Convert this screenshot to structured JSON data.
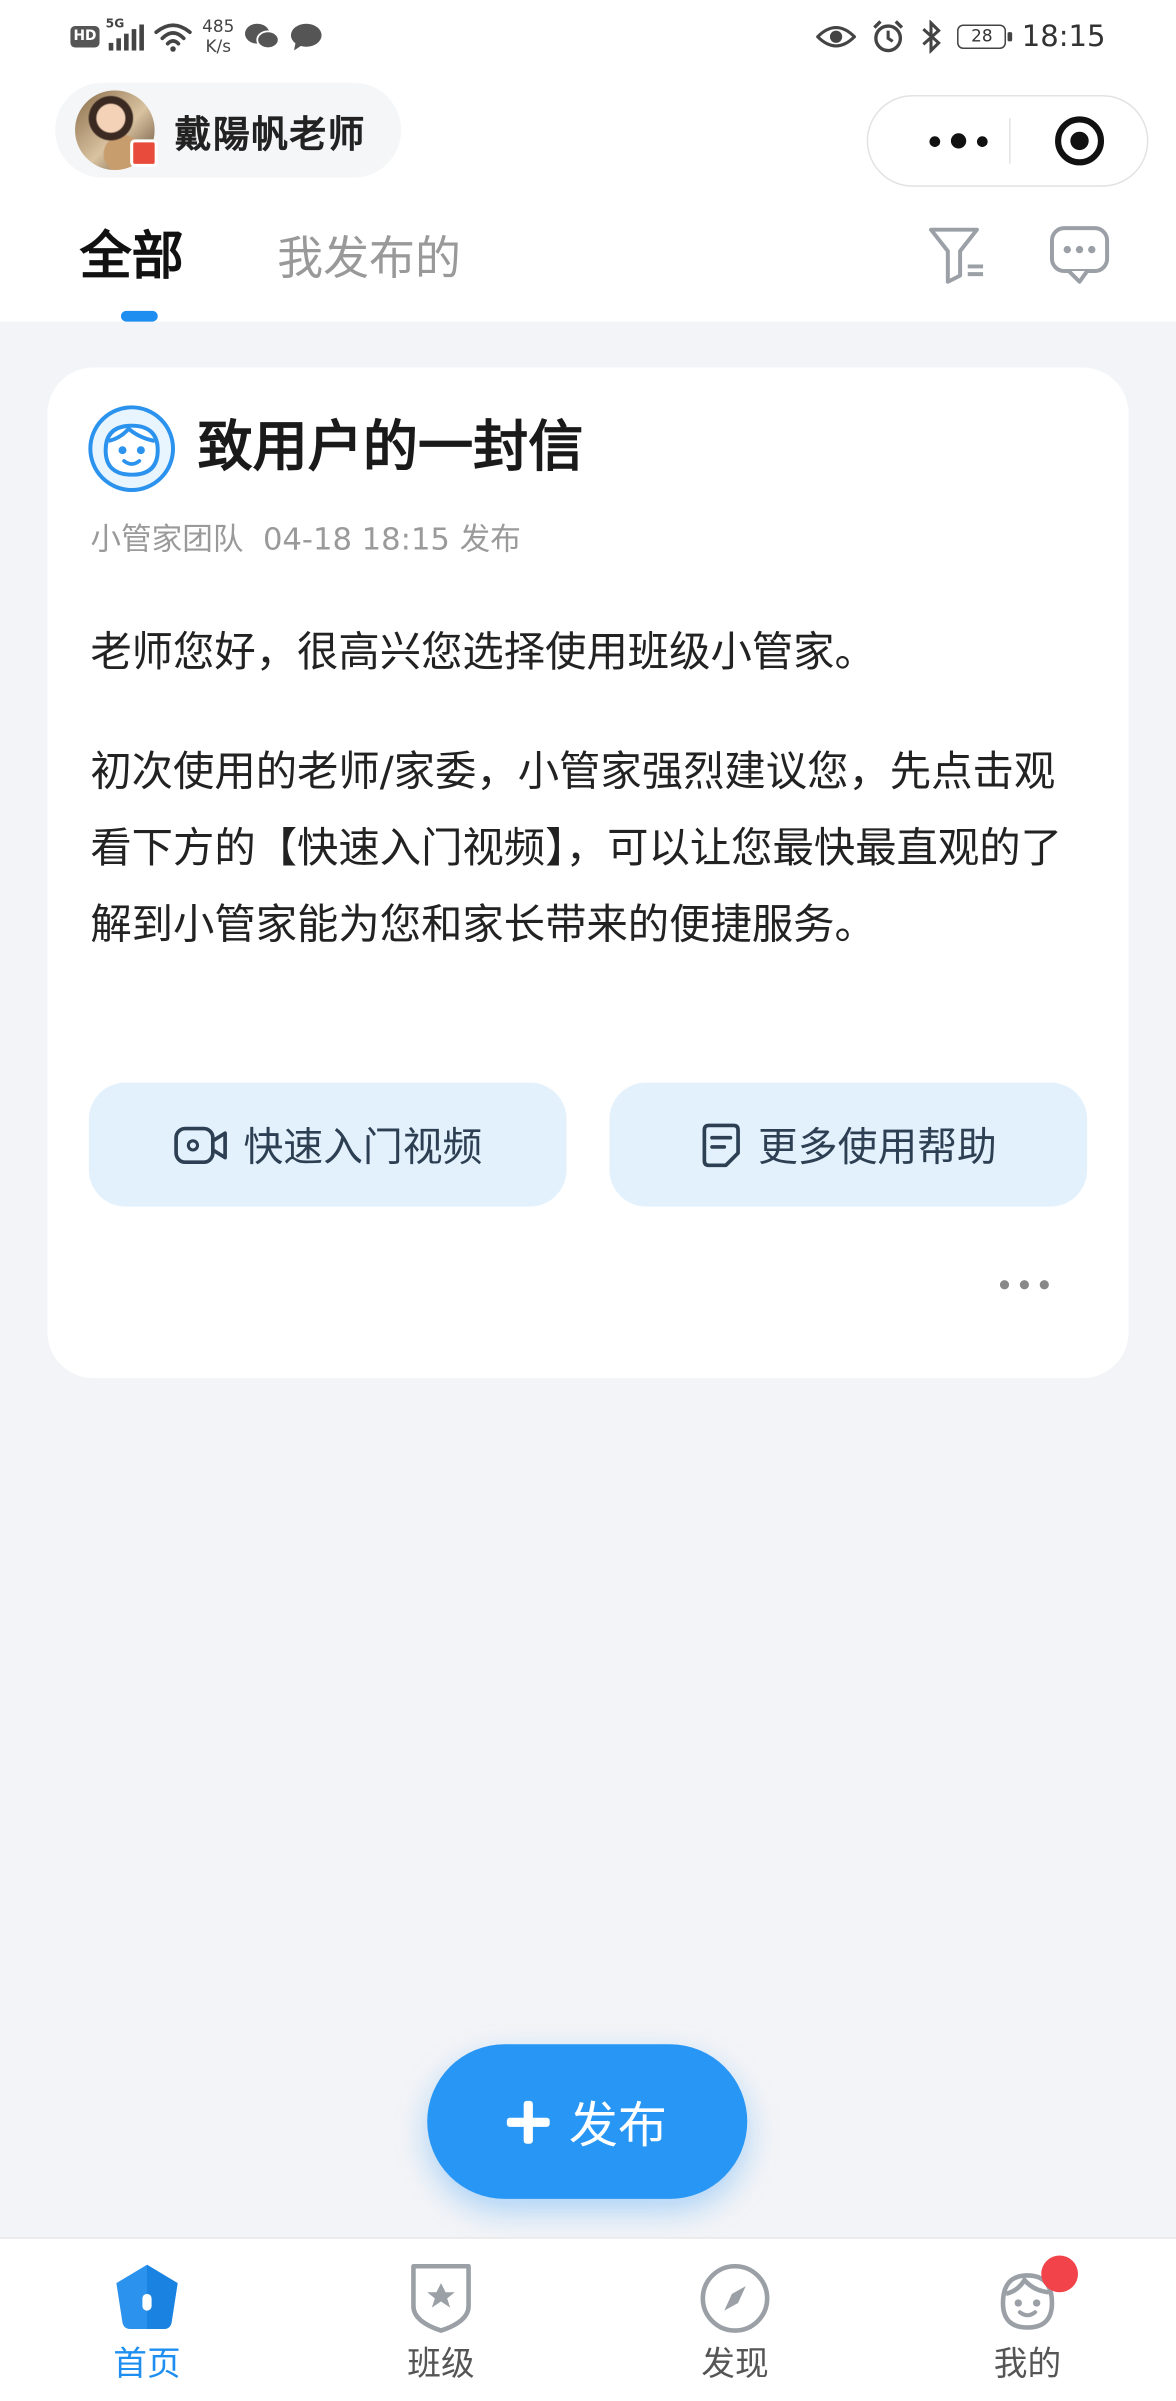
{
  "status_bar": {
    "net_type": "HD",
    "signal": "5G",
    "speed_value": "485",
    "speed_unit": "K/s",
    "battery": "28",
    "time": "18:15"
  },
  "header": {
    "user_name": "戴陽帆老师",
    "tabs": [
      {
        "label": "全部",
        "active": true
      },
      {
        "label": "我发布的",
        "active": false
      }
    ]
  },
  "card": {
    "title": "致用户的一封信",
    "meta": "小管家团队  04-18 18:15 发布",
    "paragraphs": [
      "老师您好，很高兴您选择使用班级小管家。",
      "初次使用的老师/家委，小管家强烈建议您，先点击观看下方的【快速入门视频】，可以让您最快最直观的了解到小管家能为您和家长带来的便捷服务。"
    ],
    "buttons": [
      {
        "label": "快速入门视频",
        "icon": "video-icon"
      },
      {
        "label": "更多使用帮助",
        "icon": "document-icon"
      }
    ]
  },
  "fab": {
    "label": "发布"
  },
  "bottom_nav": [
    {
      "label": "首页",
      "icon": "home-icon",
      "active": true
    },
    {
      "label": "班级",
      "icon": "class-icon",
      "active": false
    },
    {
      "label": "发现",
      "icon": "compass-icon",
      "active": false
    },
    {
      "label": "我的",
      "icon": "profile-icon",
      "active": false,
      "badge": true
    }
  ],
  "colors": {
    "accent": "#1e8ff0",
    "fab": "#2896f5",
    "button_bg": "#e3f1fd",
    "background": "#f3f4f7",
    "badge": "#f2434a"
  }
}
